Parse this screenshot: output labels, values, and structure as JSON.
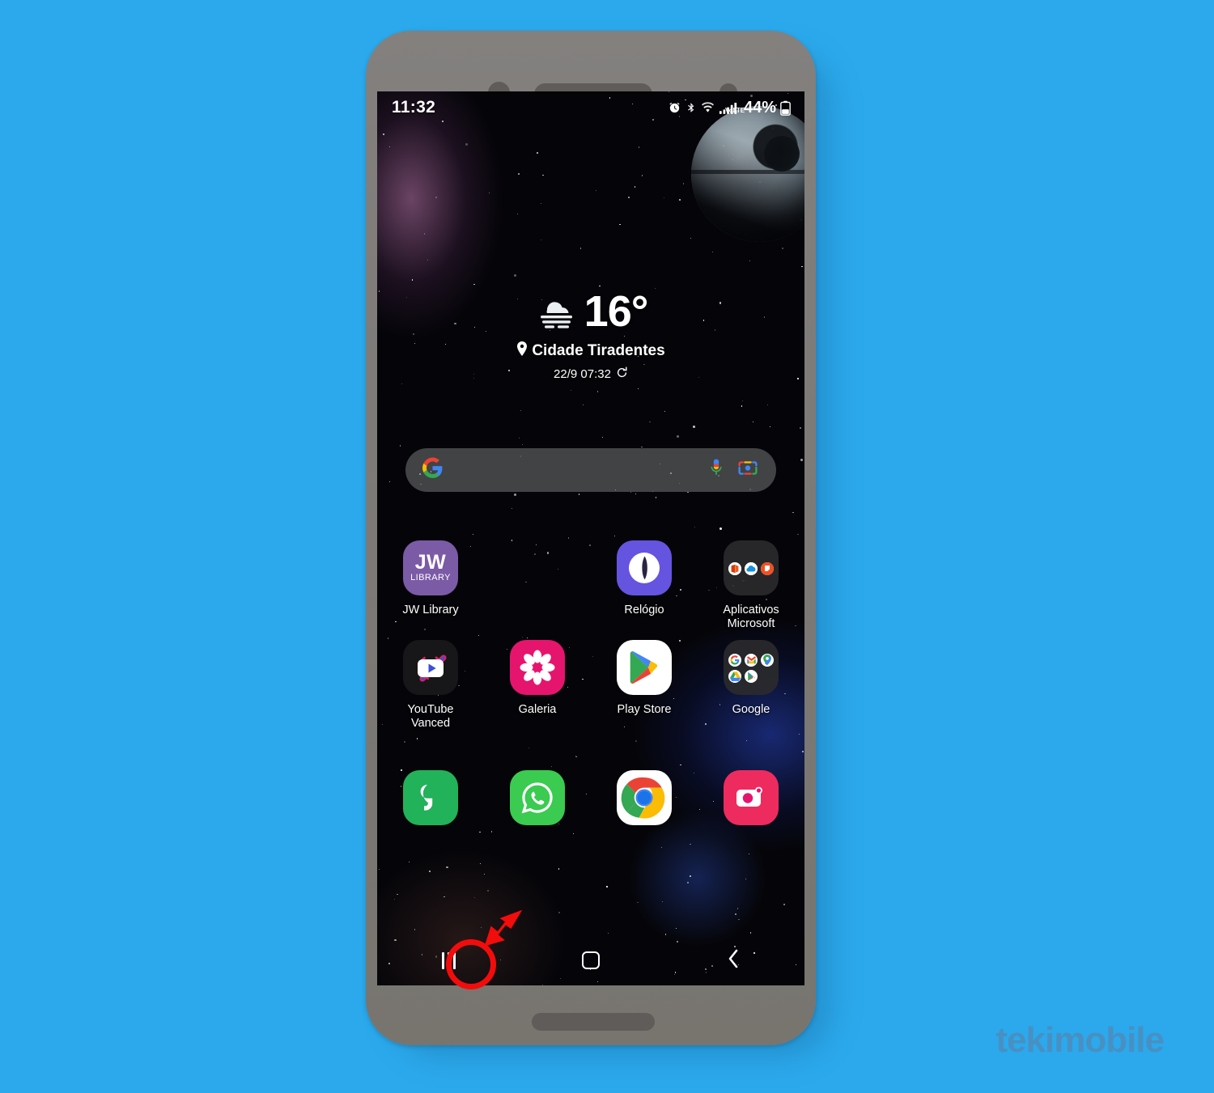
{
  "canvas": {
    "background_color": "#2BA9EC",
    "watermark": "tekimobile",
    "watermark_color": "#4A8FC0"
  },
  "device": {
    "frame_color": "#7d7a78",
    "screen_background": "space-galaxy-wallpaper"
  },
  "status_bar": {
    "time": "11:32",
    "battery_percent": "44%",
    "network_label": "VoLTE",
    "network_sub": "LTE1",
    "icons": [
      "alarm-icon",
      "bluetooth-icon",
      "wifi-icon",
      "volte-icon",
      "signal-icon",
      "battery-icon"
    ]
  },
  "weather_widget": {
    "icon": "fog-cloud-icon",
    "temperature": "16°",
    "location": "Cidade Tiradentes",
    "location_icon": "location-pin-icon",
    "updated": "22/9 07:32",
    "refresh_icon": "refresh-icon"
  },
  "search": {
    "placeholder": "",
    "value": "",
    "logo": "google-g-icon",
    "mic_icon": "microphone-icon",
    "lens_icon": "google-lens-icon"
  },
  "home_screen": {
    "rows": [
      [
        {
          "label": "JW Library",
          "icon": "jw-library-icon",
          "type": "app"
        },
        {
          "label": "",
          "icon": "",
          "type": "empty"
        },
        {
          "label": "Relógio",
          "icon": "clock-icon",
          "type": "app"
        },
        {
          "label": "Aplicativos Microsoft",
          "icon": "microsoft-folder-icon",
          "type": "folder",
          "contents": [
            "office-icon",
            "onedrive-icon",
            "sticky-notes-icon"
          ]
        }
      ],
      [
        {
          "label": "YouTube Vanced",
          "icon": "youtube-vanced-icon",
          "type": "app"
        },
        {
          "label": "Galeria",
          "icon": "gallery-icon",
          "type": "app"
        },
        {
          "label": "Play Store",
          "icon": "play-store-icon",
          "type": "app"
        },
        {
          "label": "Google",
          "icon": "google-folder-icon",
          "type": "folder",
          "contents": [
            "google-search-icon",
            "gmail-icon",
            "maps-icon",
            "drive-icon",
            "play-icon"
          ]
        }
      ]
    ],
    "dock": [
      {
        "label": "",
        "icon": "phone-icon",
        "type": "app"
      },
      {
        "label": "",
        "icon": "whatsapp-icon",
        "type": "app"
      },
      {
        "label": "",
        "icon": "chrome-icon",
        "type": "app"
      },
      {
        "label": "",
        "icon": "camera-icon",
        "type": "app"
      }
    ]
  },
  "navigation_bar": {
    "recents": {
      "icon": "recents-icon",
      "highlighted": true
    },
    "home": {
      "icon": "home-icon"
    },
    "back": {
      "icon": "back-icon"
    }
  },
  "annotation": {
    "highlight_color": "#F20C0C",
    "target": "recents-button",
    "arrow": "red-arrow-icon"
  }
}
